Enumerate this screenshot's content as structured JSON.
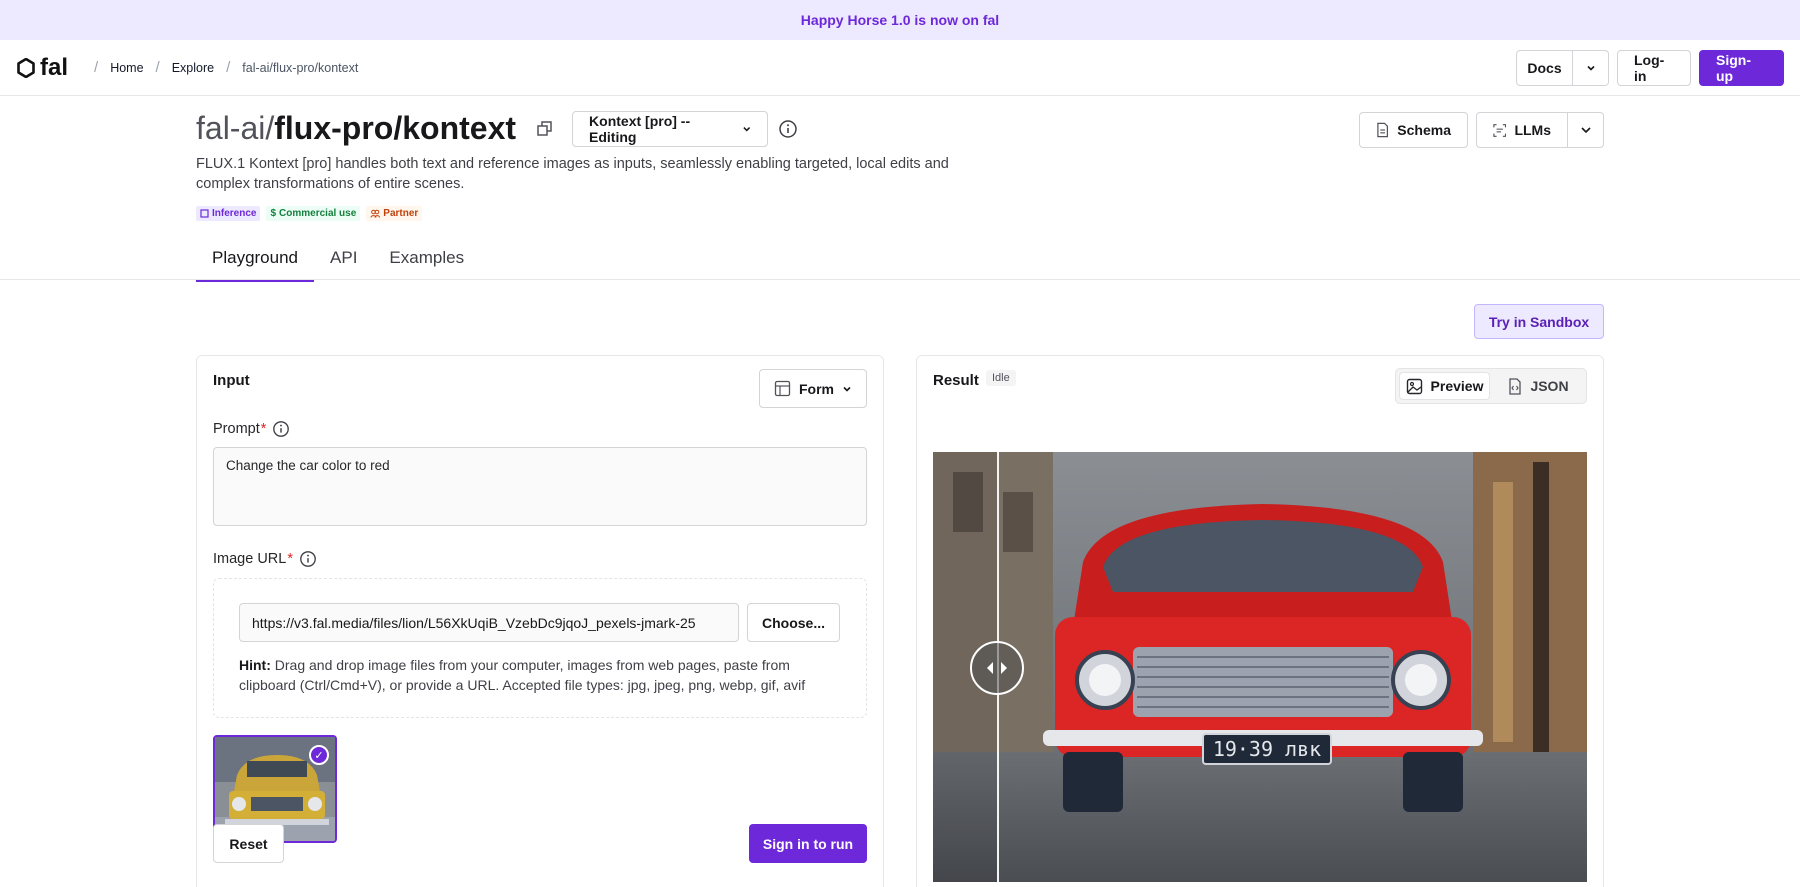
{
  "banner": {
    "text": "Happy Horse 1.0 is now on fal"
  },
  "nav": {
    "logo": "fal",
    "breadcrumbs": [
      "Home",
      "Explore",
      "fal-ai/flux-pro/kontext"
    ],
    "docs": "Docs",
    "login": "Log-in",
    "signup": "Sign-up"
  },
  "model": {
    "namespace": "fal-ai/",
    "name": "flux-pro/kontext",
    "variant": "Kontext [pro] -- Editing",
    "description": "FLUX.1 Kontext [pro] handles both text and reference images as inputs, seamlessly enabling targeted, local edits and complex transformations of entire scenes.",
    "badges": [
      "Inference",
      "Commercial use",
      "Partner"
    ],
    "schema": "Schema",
    "llms": "LLMs"
  },
  "tabs": [
    "Playground",
    "API",
    "Examples"
  ],
  "sandbox": "Try in Sandbox",
  "input": {
    "title": "Input",
    "form_mode": "Form",
    "prompt_label": "Prompt",
    "prompt_required": "*",
    "prompt_value": "Change the car color to red",
    "image_label": "Image URL",
    "image_required": "*",
    "image_url": "https://v3.fal.media/files/lion/L56XkUqiB_VzebDc9jqoJ_pexels-jmark-25",
    "choose": "Choose...",
    "hint_bold": "Hint:",
    "hint_text": " Drag and drop image files from your computer, images from web pages, paste from clipboard (Ctrl/Cmd+V), or provide a URL. Accepted file types: jpg, jpeg, png, webp, gif, avif",
    "reset": "Reset",
    "run": "Sign in to run"
  },
  "result": {
    "title": "Result",
    "status": "Idle",
    "preview": "Preview",
    "json": "JSON",
    "plate": "19·39 лвк"
  },
  "colors": {
    "accent": "#6d28d9",
    "banner_bg": "#ede9fe"
  }
}
